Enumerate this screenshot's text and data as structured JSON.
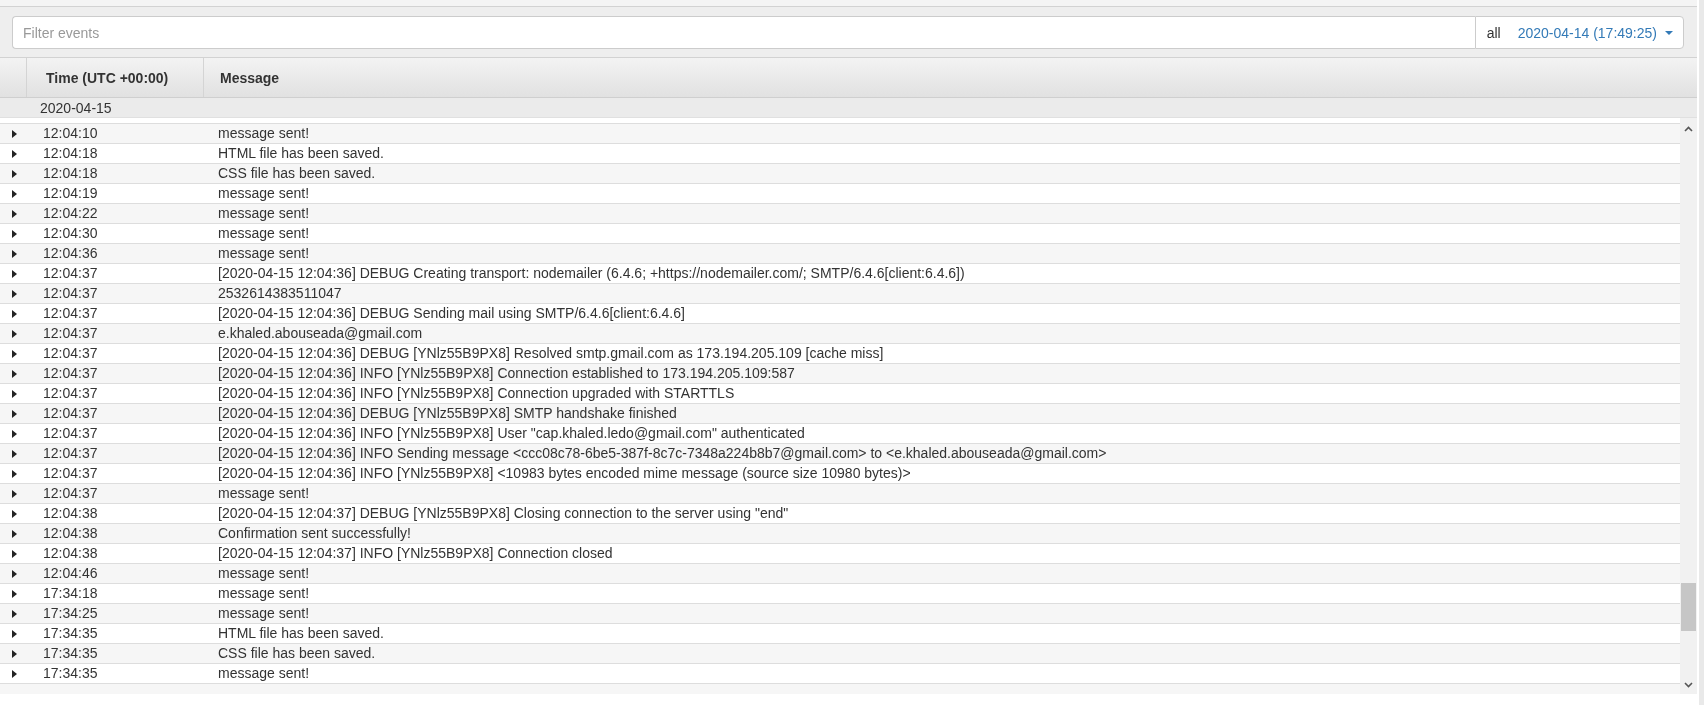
{
  "filter": {
    "placeholder": "Filter events"
  },
  "range": {
    "label": "all",
    "value": "2020-04-14 (17:49:25)"
  },
  "table": {
    "columns": [
      "Time (UTC +00:00)",
      "Message"
    ],
    "group": {
      "date": "2020-04-15"
    },
    "rows": [
      {
        "time": "12:04:10",
        "message": "message sent!",
        "expanded": false
      },
      {
        "time": "12:04:18",
        "message": "HTML file has been saved.",
        "expanded": false
      },
      {
        "time": "12:04:18",
        "message": "CSS file has been saved.",
        "expanded": false
      },
      {
        "time": "12:04:19",
        "message": "message sent!",
        "expanded": false
      },
      {
        "time": "12:04:22",
        "message": "message sent!",
        "expanded": false
      },
      {
        "time": "12:04:30",
        "message": "message sent!",
        "expanded": false
      },
      {
        "time": "12:04:36",
        "message": "message sent!",
        "expanded": false
      },
      {
        "time": "12:04:37",
        "message": "[2020-04-15 12:04:36] DEBUG Creating transport: nodemailer (6.4.6; +https://nodemailer.com/; SMTP/6.4.6[client:6.4.6])",
        "expanded": false
      },
      {
        "time": "12:04:37",
        "message": "2532614383511047",
        "expanded": false
      },
      {
        "time": "12:04:37",
        "message": "[2020-04-15 12:04:36] DEBUG Sending mail using SMTP/6.4.6[client:6.4.6]",
        "expanded": false
      },
      {
        "time": "12:04:37",
        "message": "e.khaled.abouseada@gmail.com",
        "expanded": false
      },
      {
        "time": "12:04:37",
        "message": "[2020-04-15 12:04:36] DEBUG [YNlz55B9PX8] Resolved smtp.gmail.com as 173.194.205.109 [cache miss]",
        "expanded": false
      },
      {
        "time": "12:04:37",
        "message": "[2020-04-15 12:04:36] INFO [YNlz55B9PX8] Connection established to 173.194.205.109:587",
        "expanded": false
      },
      {
        "time": "12:04:37",
        "message": "[2020-04-15 12:04:36] INFO [YNlz55B9PX8] Connection upgraded with STARTTLS",
        "expanded": false
      },
      {
        "time": "12:04:37",
        "message": "[2020-04-15 12:04:36] DEBUG [YNlz55B9PX8] SMTP handshake finished",
        "expanded": false
      },
      {
        "time": "12:04:37",
        "message": "[2020-04-15 12:04:36] INFO [YNlz55B9PX8] User \"cap.khaled.ledo@gmail.com\" authenticated",
        "expanded": false
      },
      {
        "time": "12:04:37",
        "message": "[2020-04-15 12:04:36] INFO Sending message <ccc08c78-6be5-387f-8c7c-7348a224b8b7@gmail.com> to <e.khaled.abouseada@gmail.com>",
        "expanded": false
      },
      {
        "time": "12:04:37",
        "message": "[2020-04-15 12:04:36] INFO [YNlz55B9PX8] <10983 bytes encoded mime message (source size 10980 bytes)>",
        "expanded": false
      },
      {
        "time": "12:04:37",
        "message": "message sent!",
        "expanded": false
      },
      {
        "time": "12:04:38",
        "message": "[2020-04-15 12:04:37] DEBUG [YNlz55B9PX8] Closing connection to the server using \"end\"",
        "expanded": false
      },
      {
        "time": "12:04:38",
        "message": "Confirmation sent successfully!",
        "expanded": false
      },
      {
        "time": "12:04:38",
        "message": "[2020-04-15 12:04:37] INFO [YNlz55B9PX8] Connection closed",
        "expanded": false
      },
      {
        "time": "12:04:46",
        "message": "message sent!",
        "expanded": false
      },
      {
        "time": "17:34:18",
        "message": "message sent!",
        "expanded": false
      },
      {
        "time": "17:34:25",
        "message": "message sent!",
        "expanded": false
      },
      {
        "time": "17:34:35",
        "message": "HTML file has been saved.",
        "expanded": false
      },
      {
        "time": "17:34:35",
        "message": "CSS file has been saved.",
        "expanded": false
      },
      {
        "time": "17:34:35",
        "message": "message sent!",
        "expanded": false
      }
    ]
  }
}
